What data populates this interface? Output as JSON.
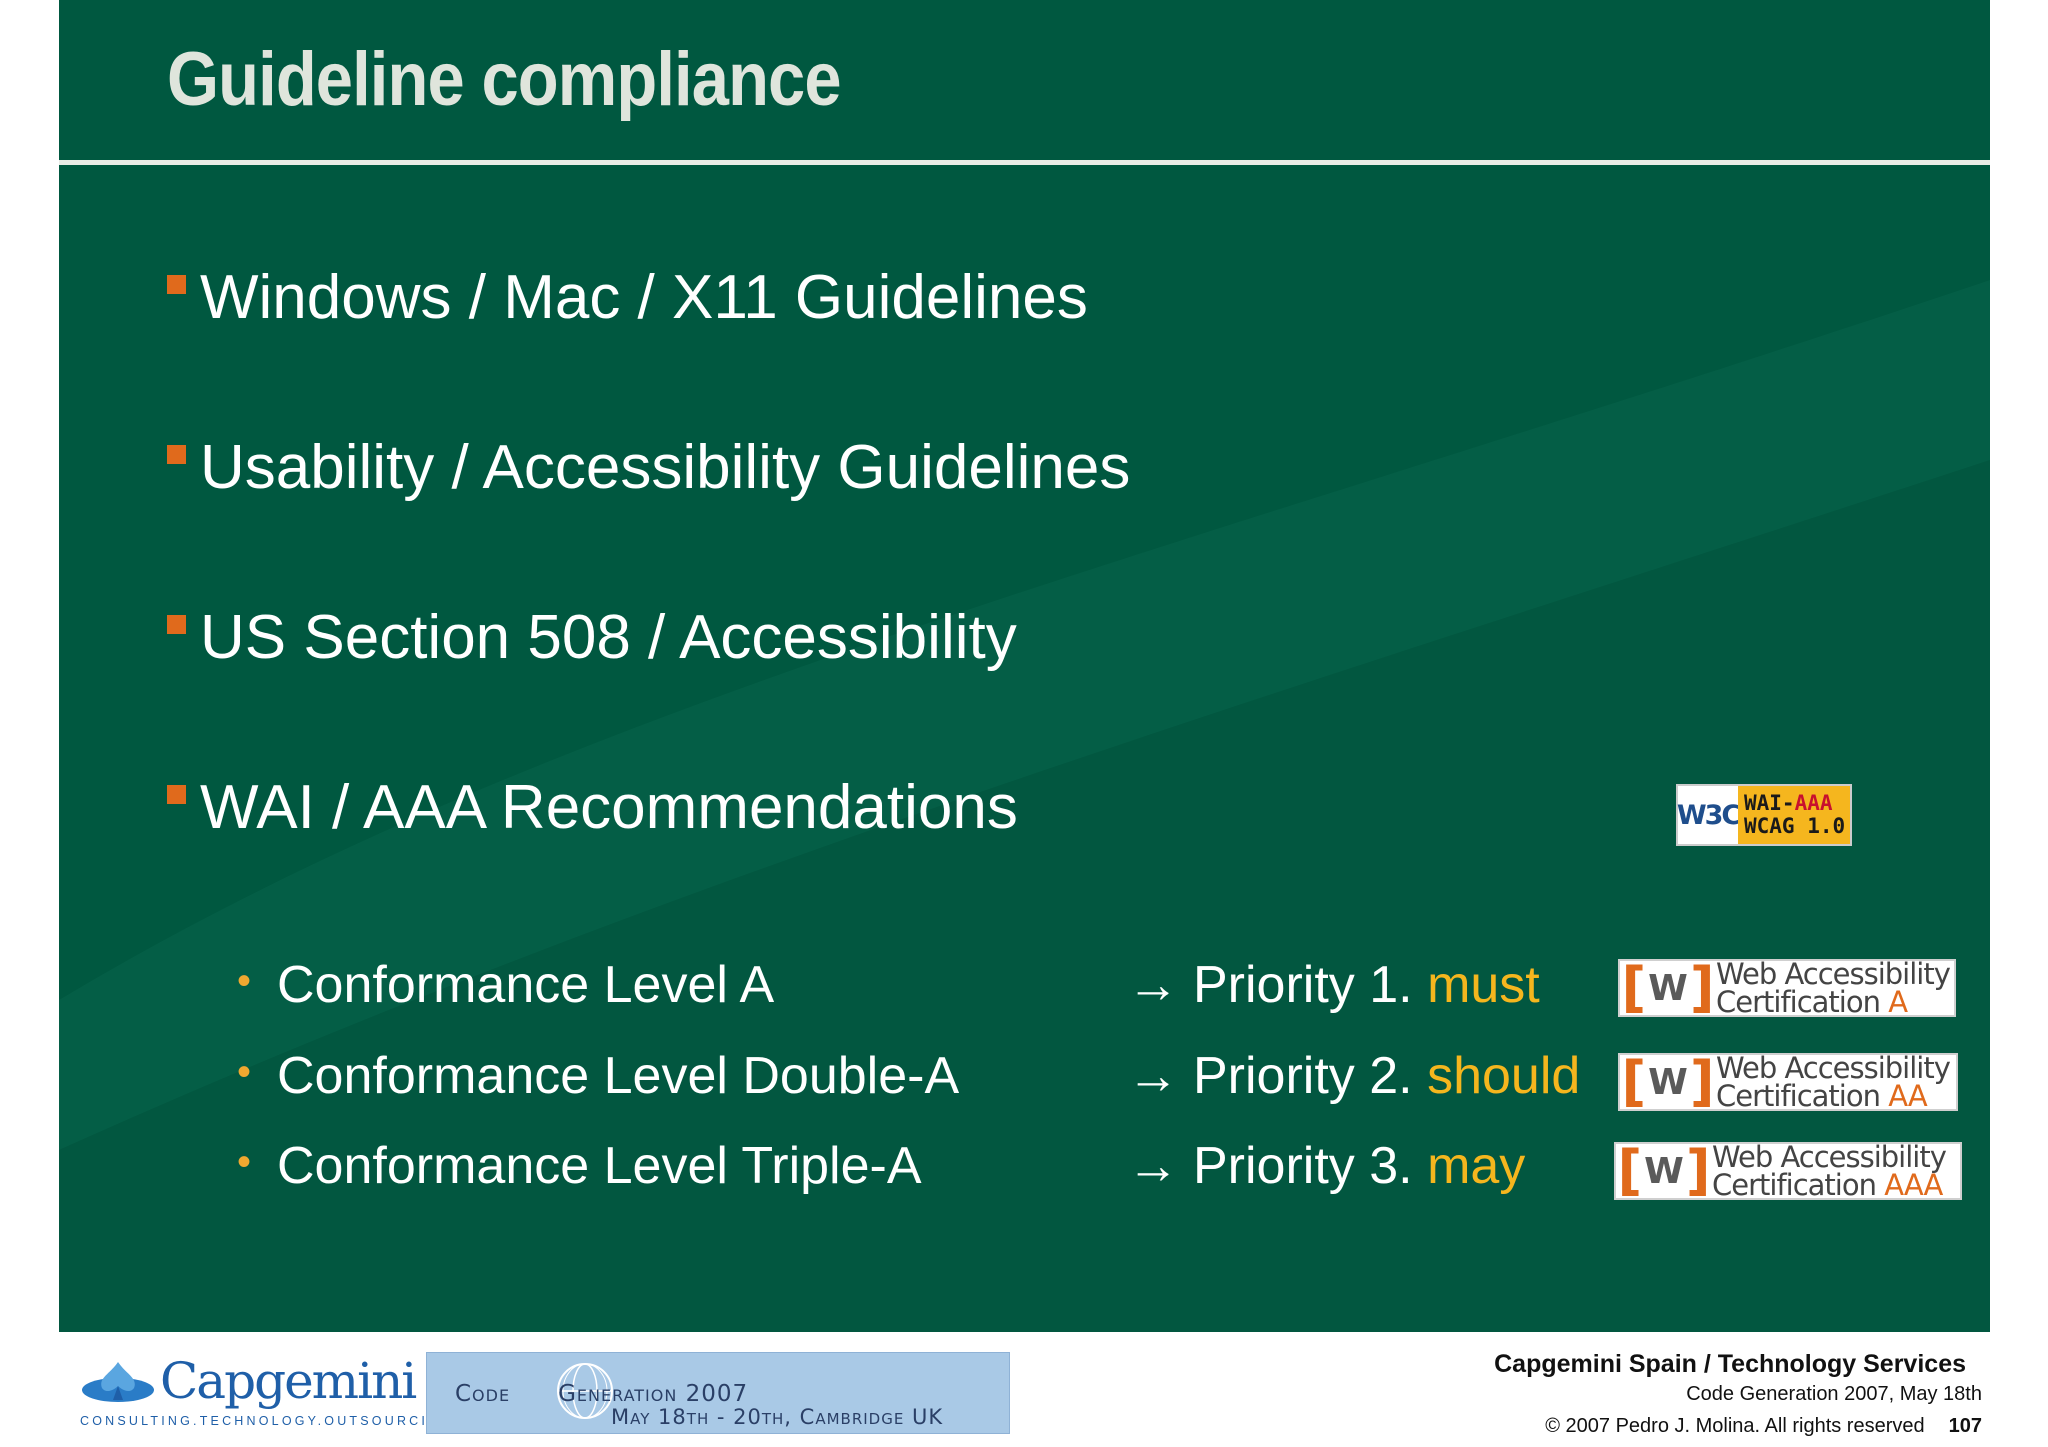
{
  "slide": {
    "title": "Guideline compliance",
    "bullets": [
      "Windows / Mac / X11 Guidelines",
      "Usability / Accessibility Guidelines",
      "US Section 508 / Accessibility",
      "WAI / AAA Recommendations"
    ],
    "sub_items": [
      {
        "level": "Conformance Level A",
        "priority": "Priority 1.",
        "keyword": "must",
        "badge_line1": "Web Accessibility",
        "badge_line2": "Certification",
        "badge_level": "A"
      },
      {
        "level": "Conformance Level Double-A",
        "priority": "Priority 2.",
        "keyword": "should",
        "badge_line1": "Web Accessibility",
        "badge_line2": "Certification",
        "badge_level": "AA"
      },
      {
        "level": "Conformance Level Triple-A",
        "priority": "Priority 3.",
        "keyword": "may",
        "badge_line1": "Web Accessibility",
        "badge_line2": "Certification",
        "badge_level": "AAA"
      }
    ],
    "wai_badge": {
      "w3c": "W3C",
      "line1_prefix": "WAI-",
      "line1_level": "AAA",
      "line2": "WCAG 1.0"
    },
    "arrow_symbol": "→",
    "bullet_dot": "•"
  },
  "footer": {
    "logo_name": "Capgemini",
    "logo_tagline": "CONSULTING.TECHNOLOGY.OUTSOURCING",
    "banner_title_left": "Code",
    "banner_title_right": "Generation 2007",
    "banner_dates": "May 18th - 20th, Cambridge UK",
    "company": "Capgemini Spain / Technology Services",
    "event": "Code Generation 2007, May 18th",
    "copyright": "© 2007 Pedro J. Molina. All rights reserved",
    "page_number": "107"
  },
  "colors": {
    "slide_bg": "#005840",
    "title": "#dfe5dc",
    "bullet_square": "#e06a1c",
    "highlight": "#f5b61e",
    "brand_blue": "#1f5fa8"
  }
}
